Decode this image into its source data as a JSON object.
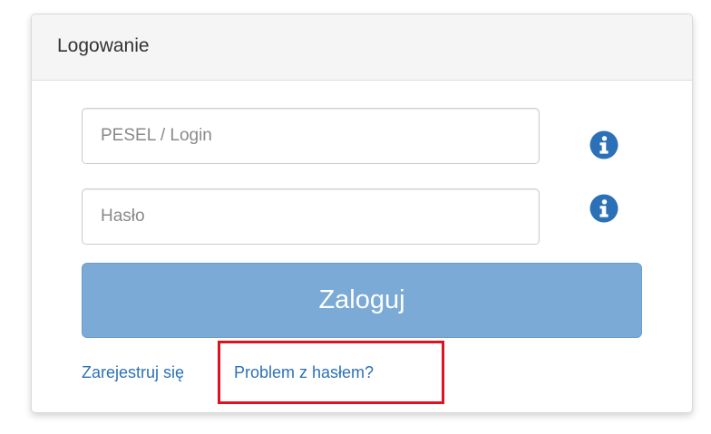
{
  "panel": {
    "title": "Logowanie"
  },
  "form": {
    "login_placeholder": "PESEL / Login",
    "login_value": "",
    "password_placeholder": "Hasło",
    "password_value": "",
    "submit_label": "Zaloguj"
  },
  "links": {
    "register_label": "Zarejestruj się",
    "password_problem_label": "Problem z hasłem?"
  },
  "icons": {
    "login_info": "info-circle-icon",
    "password_info": "info-circle-icon"
  },
  "colors": {
    "accent_button": "#7aaad5",
    "link": "#2c71b7",
    "info_icon": "#2c71b7",
    "highlight_box": "#e0121f"
  }
}
